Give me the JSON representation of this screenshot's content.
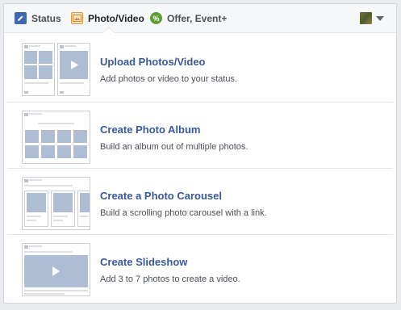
{
  "tabs": {
    "status": "Status",
    "photo_video": "Photo/Video",
    "offer_event": "Offer, Event+"
  },
  "icons": {
    "status": "pencil-icon",
    "photo_video": "photo-icon",
    "offer_event": "offer-icon",
    "audience": "avatar",
    "dropdown": "chevron-down-icon"
  },
  "options": [
    {
      "title": "Upload Photos/Video",
      "description": "Add photos or video to your status."
    },
    {
      "title": "Create Photo Album",
      "description": "Build an album out of multiple photos."
    },
    {
      "title": "Create a Photo Carousel",
      "description": "Build a scrolling photo carousel with a link."
    },
    {
      "title": "Create Slideshow",
      "description": "Add 3 to 7 photos to create a video."
    }
  ],
  "colors": {
    "link": "#385898",
    "text": "#4b4f56",
    "accent": "#4267b2",
    "placeholder": "#afbdd4"
  }
}
